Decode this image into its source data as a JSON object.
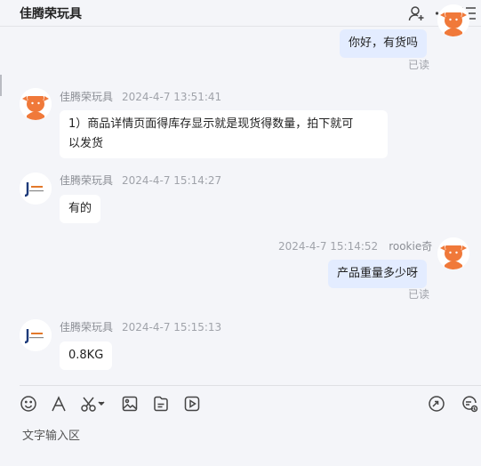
{
  "header": {
    "title": "佳腾荣玩具",
    "icons": [
      "add-user-icon",
      "more-icon",
      "menu-icon"
    ]
  },
  "messages": [
    {
      "direction": "out",
      "text": "你好，有货吗",
      "status": "已读"
    },
    {
      "direction": "in",
      "sender": "佳腾荣玩具",
      "time": "2024-4-7 13:51:41",
      "lines": [
        "1）商品详情页面得库存显示就是现货得数量，拍下就可",
        "以发货"
      ]
    },
    {
      "direction": "in",
      "sender": "佳腾荣玩具",
      "time": "2024-4-7 15:14:27",
      "text": "有的"
    },
    {
      "direction": "out",
      "sender": "rookie奇",
      "time": "2024-4-7 15:14:52",
      "text": "产品重量多少呀",
      "status": "已读"
    },
    {
      "direction": "in",
      "sender": "佳腾荣玩具",
      "time": "2024-4-7 15:15:13",
      "text": "0.8KG"
    }
  ],
  "toolbar": {
    "left_icons": [
      "emoji-icon",
      "font-icon",
      "scissors-icon",
      "image-icon",
      "file-icon",
      "video-icon"
    ],
    "right_icons": [
      "send-link-icon",
      "quick-reply-icon"
    ]
  },
  "input": {
    "placeholder": "文字输入区"
  },
  "colors": {
    "background": "#f4f5f9",
    "bubble_out": "#e3ecff",
    "bubble_in": "#ffffff",
    "avatar_orange": "#f0793a"
  }
}
